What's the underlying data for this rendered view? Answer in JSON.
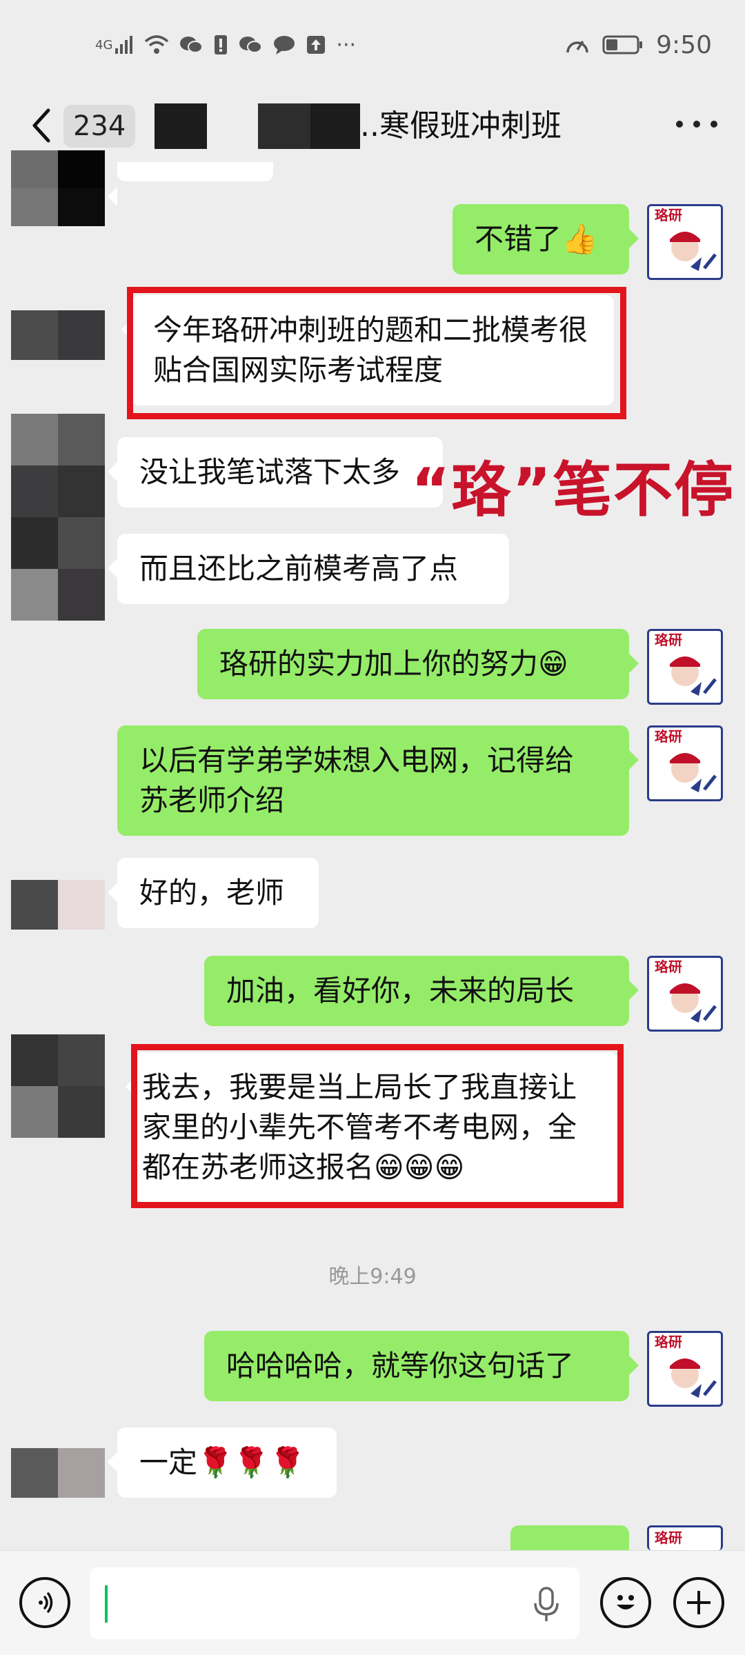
{
  "status_bar": {
    "network": "4G",
    "time": "9:50",
    "more": "···"
  },
  "header": {
    "back_label": "<",
    "unread_count": "234",
    "title": "..寒假班冲刺班"
  },
  "overlay_text": "“珞”笔不停",
  "messages": [
    {
      "side": "right",
      "text": "不错了👍"
    },
    {
      "side": "left",
      "text": "今年珞研冲刺班的题和二批模考很\n贴合国网实际考试程度"
    },
    {
      "side": "left",
      "text": "没让我笔试落下太多"
    },
    {
      "side": "left",
      "text": "而且还比之前模考高了点"
    },
    {
      "side": "right",
      "text": "珞研的实力加上你的努力😁"
    },
    {
      "side": "right",
      "text": "以后有学弟学妹想入电网，记得给\n苏老师介绍"
    },
    {
      "side": "left",
      "text": "好的，老师"
    },
    {
      "side": "right",
      "text": "加油，看好你，未来的局长"
    },
    {
      "side": "left",
      "text": "我去，我要是当上局长了我直接让\n家里的小辈先不管考不考电网，全\n都在苏老师这报名😁😁😁"
    },
    {
      "side": "right",
      "text": "哈哈哈哈，就等你这句话了"
    },
    {
      "side": "left",
      "text": "一定🌹🌹🌹"
    }
  ],
  "timestamp": "晚上9:49",
  "input": {
    "value": "",
    "voice_icon": "voice-icon",
    "emoji_icon": "emoji-icon",
    "plus_icon": "plus-icon"
  }
}
